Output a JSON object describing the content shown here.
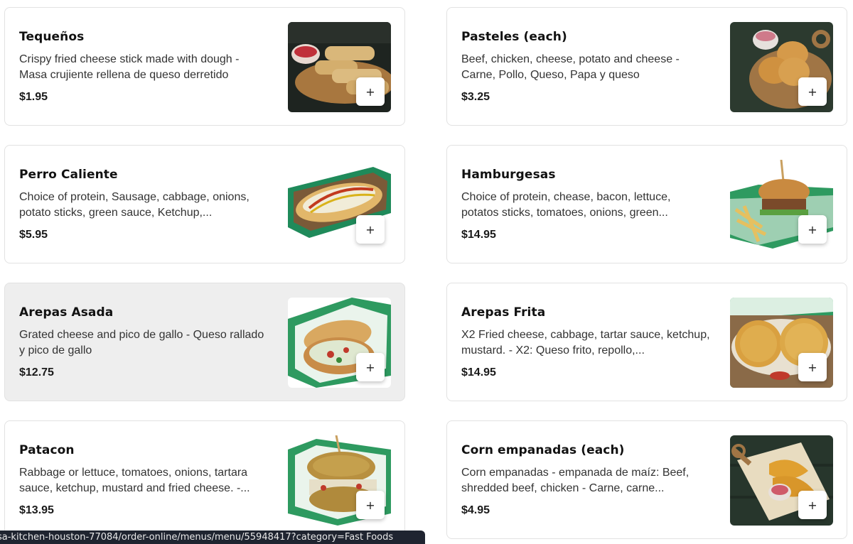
{
  "menu": {
    "items": [
      {
        "name": "Tequeños",
        "description": "Crispy fried cheese stick made with dough - Masa crujiente rellena de queso derretido",
        "price": "$1.95",
        "image_icon": "tequenos-photo"
      },
      {
        "name": "Pasteles (each)",
        "description": "Beef, chicken, cheese, potato and cheese - Carne, Pollo, Queso, Papa y queso",
        "price": "$3.25",
        "image_icon": "pasteles-photo"
      },
      {
        "name": "Perro Caliente",
        "description": "Choice of protein, Sausage, cabbage, onions, potato sticks, green sauce, Ketchup,...",
        "price": "$5.95",
        "image_icon": "hotdog-photo"
      },
      {
        "name": "Hamburgesas",
        "description": "Choice of protein, chease, bacon, lettuce, potatos sticks, tomatoes, onions, green...",
        "price": "$14.95",
        "image_icon": "burger-photo"
      },
      {
        "name": "Arepas Asada",
        "description": "Grated cheese and pico de gallo - Queso rallado y pico de gallo",
        "price": "$12.75",
        "image_icon": "arepa-asada-photo"
      },
      {
        "name": "Arepas Frita",
        "description": "X2 Fried cheese, cabbage, tartar sauce, ketchup, mustard. - X2: Queso frito, repollo,...",
        "price": "$14.95",
        "image_icon": "arepa-frita-photo"
      },
      {
        "name": "Patacon",
        "description": "Rabbage or lettuce, tomatoes, onions, tartara sauce, ketchup, mustard and fried cheese. -...",
        "price": "$13.95",
        "image_icon": "patacon-photo"
      },
      {
        "name": "Corn empanadas (each)",
        "description": "Corn empanadas - empanada de maíz: Beef, shredded beef, chicken - Carne, carne...",
        "price": "$4.95",
        "image_icon": "empanada-photo"
      }
    ],
    "add_label": "+"
  },
  "status_bar": {
    "url": "sa-kitchen-houston-77084/order-online/menus/menu/55948417?category=Fast Foods"
  },
  "colors": {
    "card_border": "#e2e2e2",
    "card_hover_bg": "#eeeeee",
    "text_primary": "#111111",
    "status_bar_bg": "#1f2430"
  }
}
